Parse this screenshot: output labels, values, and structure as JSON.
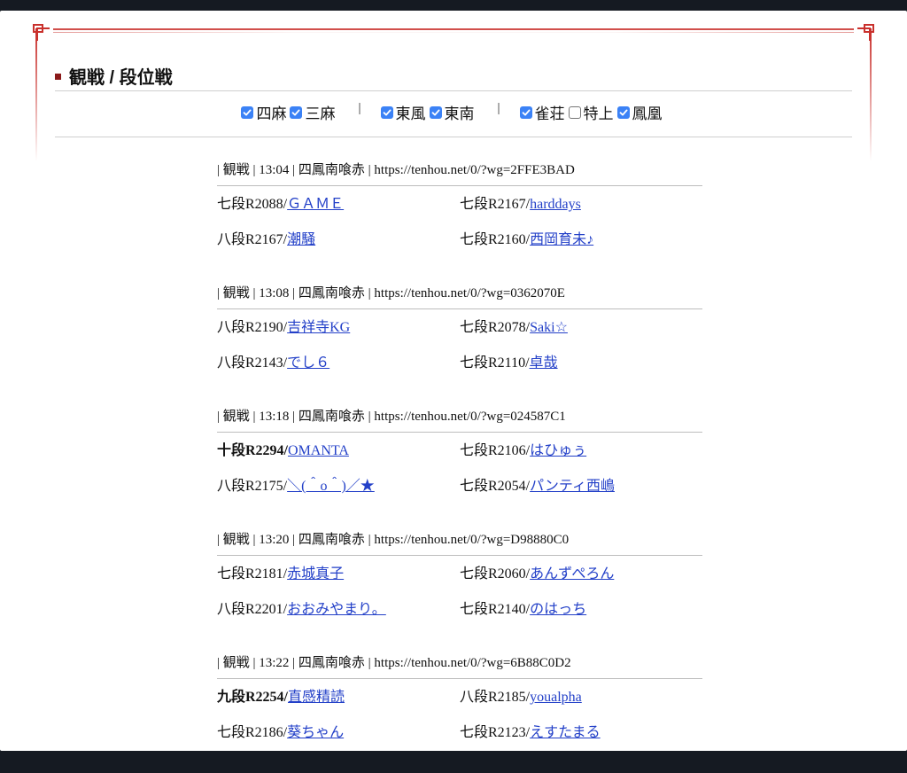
{
  "heading": {
    "title": "観戦 / 段位戦"
  },
  "filters": {
    "group1": [
      {
        "label": "四麻",
        "checked": true
      },
      {
        "label": "三麻",
        "checked": true
      }
    ],
    "group2": [
      {
        "label": "東風",
        "checked": true
      },
      {
        "label": "東南",
        "checked": true
      }
    ],
    "group3": [
      {
        "label": "雀荘",
        "checked": true
      },
      {
        "label": "特上",
        "checked": false
      },
      {
        "label": "鳳凰",
        "checked": true
      }
    ],
    "separator": "|"
  },
  "games": [
    {
      "header": "| 観戦 | 13:04 | 四鳳南喰赤 | https://tenhou.net/0/?wg=2FFE3BAD",
      "players": [
        {
          "rank": "七段R2088/",
          "name": "ＧＡＭＥ",
          "strong": false
        },
        {
          "rank": "七段R2167/",
          "name": "harddays",
          "strong": false
        },
        {
          "rank": "八段R2167/",
          "name": "潮騒",
          "strong": false
        },
        {
          "rank": "七段R2160/",
          "name": "西岡育未♪",
          "strong": false
        }
      ]
    },
    {
      "header": "| 観戦 | 13:08 | 四鳳南喰赤 | https://tenhou.net/0/?wg=0362070E",
      "players": [
        {
          "rank": "八段R2190/",
          "name": "吉祥寺KG",
          "strong": false
        },
        {
          "rank": "七段R2078/",
          "name": "Saki☆",
          "strong": false
        },
        {
          "rank": "八段R2143/",
          "name": "でし６",
          "strong": false
        },
        {
          "rank": "七段R2110/",
          "name": "卓哉",
          "strong": false
        }
      ]
    },
    {
      "header": "| 観戦 | 13:18 | 四鳳南喰赤 | https://tenhou.net/0/?wg=024587C1",
      "players": [
        {
          "rank": "十段R2294/",
          "name": "OMANTA",
          "strong": true
        },
        {
          "rank": "七段R2106/",
          "name": "はひゅぅ",
          "strong": false
        },
        {
          "rank": "八段R2175/",
          "name": "＼(＾o＾)／★",
          "strong": false
        },
        {
          "rank": "七段R2054/",
          "name": "パンティ西嶋",
          "strong": false
        }
      ]
    },
    {
      "header": "| 観戦 | 13:20 | 四鳳南喰赤 | https://tenhou.net/0/?wg=D98880C0",
      "players": [
        {
          "rank": "七段R2181/",
          "name": "赤城真子",
          "strong": false
        },
        {
          "rank": "七段R2060/",
          "name": "あんずぺろん",
          "strong": false
        },
        {
          "rank": "八段R2201/",
          "name": "おおみやまり。",
          "strong": false
        },
        {
          "rank": "七段R2140/",
          "name": "のはっち",
          "strong": false
        }
      ]
    },
    {
      "header": "| 観戦 | 13:22 | 四鳳南喰赤 | https://tenhou.net/0/?wg=6B88C0D2",
      "players": [
        {
          "rank": "九段R2254/",
          "name": "直感精読",
          "strong": true
        },
        {
          "rank": "八段R2185/",
          "name": "youalpha",
          "strong": false
        },
        {
          "rank": "七段R2186/",
          "name": "葵ちゃん",
          "strong": false
        },
        {
          "rank": "七段R2123/",
          "name": "えすたまる",
          "strong": false
        }
      ]
    }
  ]
}
